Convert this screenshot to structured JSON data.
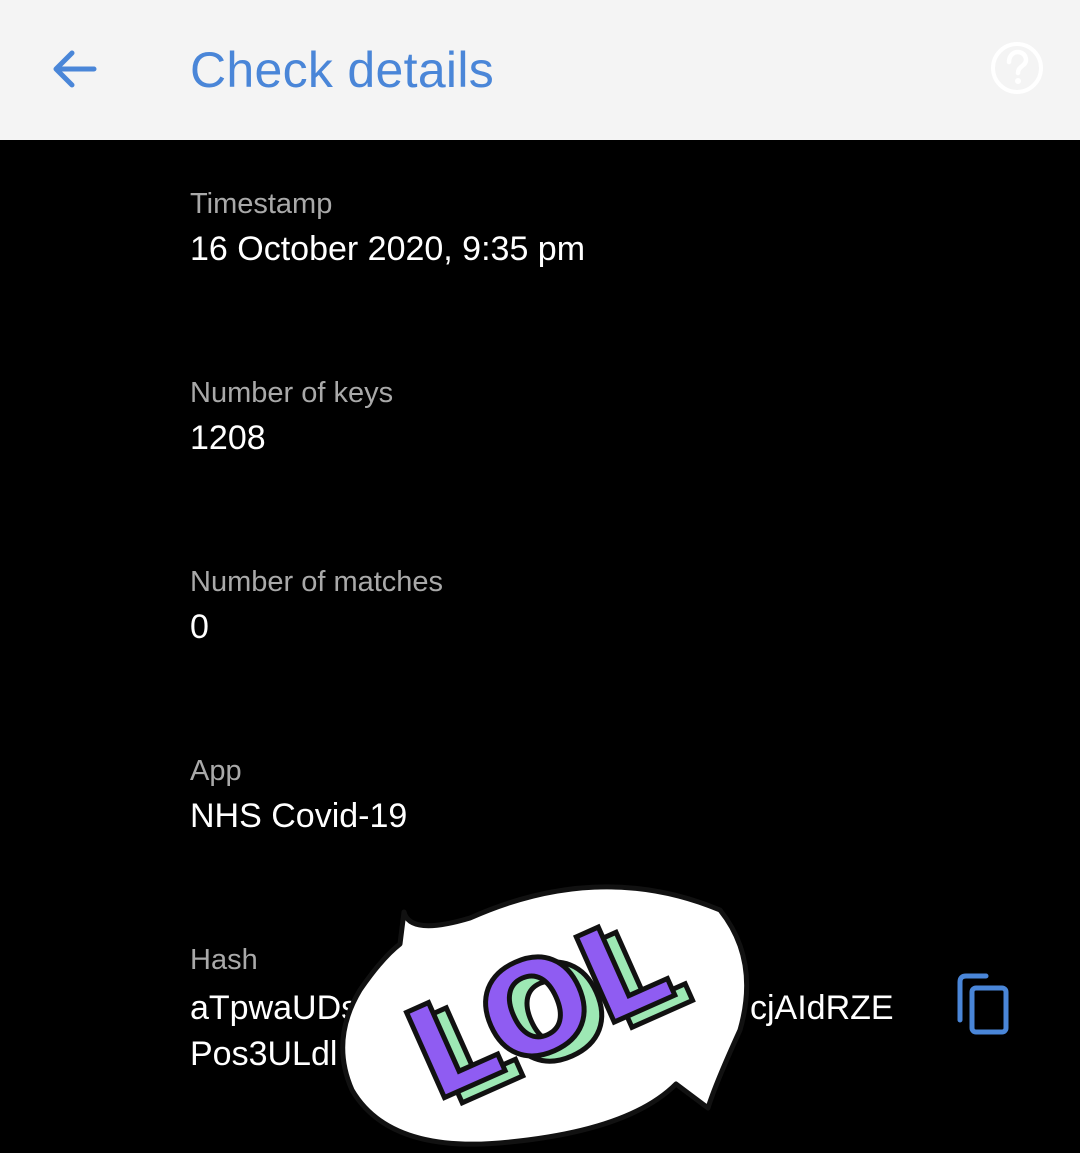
{
  "app_bar": {
    "title": "Check details",
    "back_icon": "arrow-left-icon",
    "help_icon": "help-circle-icon"
  },
  "details": {
    "timestamp": {
      "label": "Timestamp",
      "value": "16 October 2020, 9:35 pm"
    },
    "keys": {
      "label": "Number of keys",
      "value": "1208"
    },
    "matches": {
      "label": "Number of matches",
      "value": "0"
    },
    "app": {
      "label": "App",
      "value": "NHS Covid-19"
    },
    "hash": {
      "label": "Hash",
      "line1_start": "aTpwaUDs",
      "line1_end": "cjAIdRZE",
      "line2_start": "Pos3ULdl"
    }
  },
  "copy_icon": "copy-icon",
  "sticker": {
    "text": "LOL"
  },
  "colors": {
    "accent": "#4a86d8",
    "appbar_bg": "#f4f4f4",
    "background": "#000000",
    "label": "#a9a9a9",
    "value": "#ffffff",
    "sticker_purple": "#8f5cf2",
    "sticker_green": "#9de8b4"
  }
}
